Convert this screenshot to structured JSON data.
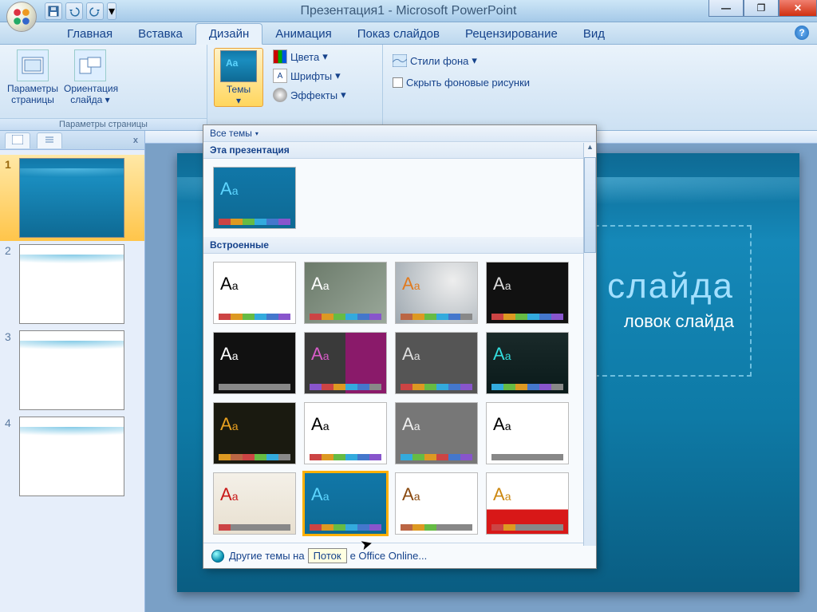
{
  "title": "Презентация1 - Microsoft PowerPoint",
  "tabs": [
    "Главная",
    "Вставка",
    "Дизайн",
    "Анимация",
    "Показ слайдов",
    "Рецензирование",
    "Вид"
  ],
  "active_tab": "Дизайн",
  "ribbon": {
    "group_page": {
      "label": "Параметры страницы",
      "page_params": "Параметры страницы",
      "orientation": "Ориентация слайда"
    },
    "group_themes": {
      "themes_btn": "Темы",
      "colors": "Цвета",
      "fonts": "Шрифты",
      "effects": "Эффекты"
    },
    "group_bg": {
      "bg_styles": "Стили фона",
      "hide_bg": "Скрыть фоновые рисунки"
    }
  },
  "drop": {
    "all_themes": "Все темы",
    "this_pres": "Эта презентация",
    "builtin": "Встроенные",
    "more_online": "Другие темы на",
    "more_online2": "e Office Online...",
    "tooltip": "Поток"
  },
  "thumb_tabs": {
    "close": "x"
  },
  "slide_nums": [
    "1",
    "2",
    "3",
    "4"
  ],
  "slide": {
    "title_fragment": "слайда",
    "subtitle_fragment": "ловок слайда"
  },
  "theme_sw": [
    {
      "bg": "linear-gradient(180deg,#1177a8,#0e6a94)",
      "aa": "#5dd5ff",
      "name": "Поток"
    }
  ]
}
